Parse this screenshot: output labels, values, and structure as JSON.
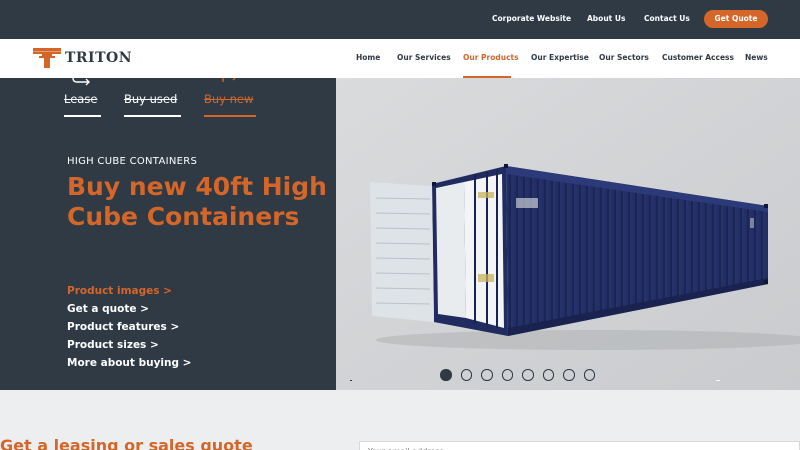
{
  "topbar": {
    "links": [
      "Corporate Website",
      "About Us",
      "Contact Us"
    ],
    "cta": "Get Quote"
  },
  "logo": {
    "text": "TRITON",
    "color": "#d4662a"
  },
  "mainnav": {
    "items": [
      "Home",
      "Our Services",
      "Our Products",
      "Our Expertise",
      "Our Sectors",
      "Customer Access",
      "News"
    ],
    "active": "Our Products"
  },
  "hero": {
    "modes": [
      {
        "label": "Lease",
        "icon": "lease-icon"
      },
      {
        "label": "Buy used",
        "icon": "buy-used-icon"
      },
      {
        "label": "Buy new",
        "icon": "buy-new-icon",
        "active": true
      }
    ],
    "eyebrow": "HIGH CUBE CONTAINERS",
    "title": "Buy new 40ft High Cube Containers",
    "links": [
      "Product images >",
      "Get a quote >",
      "Product features >",
      "Product sizes >",
      "More about buying >"
    ],
    "carousel": {
      "count": 8,
      "active_index": 0
    }
  },
  "quote_section": {
    "heading": "Get a leasing or sales quote",
    "email_placeholder": "Your email address"
  },
  "colors": {
    "accent": "#d4662a",
    "dark": "#2f3a45",
    "container": "#23306a"
  }
}
